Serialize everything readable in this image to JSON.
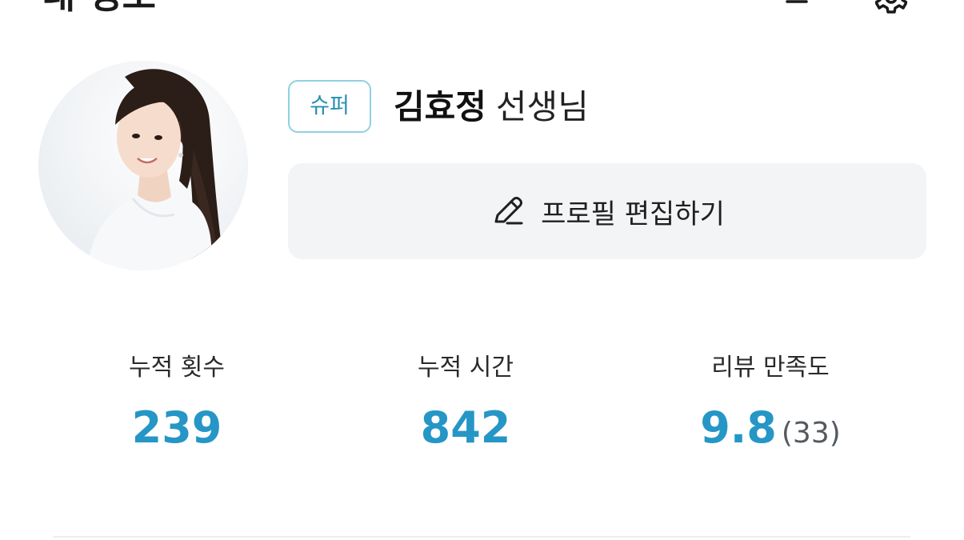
{
  "header": {
    "title": "내 정보",
    "menu_icon": "menu-lines-icon",
    "settings_icon": "gear-icon"
  },
  "profile": {
    "badge": "슈퍼",
    "name": "김효정",
    "suffix": "선생님",
    "edit_button_label": "프로필 편집하기",
    "edit_icon": "pencil-icon"
  },
  "stats": [
    {
      "label": "누적 횟수",
      "value": "239",
      "sub": ""
    },
    {
      "label": "누적 시간",
      "value": "842",
      "sub": ""
    },
    {
      "label": "리뷰 만족도",
      "value": "9.8",
      "sub": "(33)"
    }
  ],
  "colors": {
    "accent": "#2596c6",
    "badge_border": "#8fd0e4",
    "badge_text": "#2a8fb3",
    "button_bg": "#f3f4f6"
  }
}
